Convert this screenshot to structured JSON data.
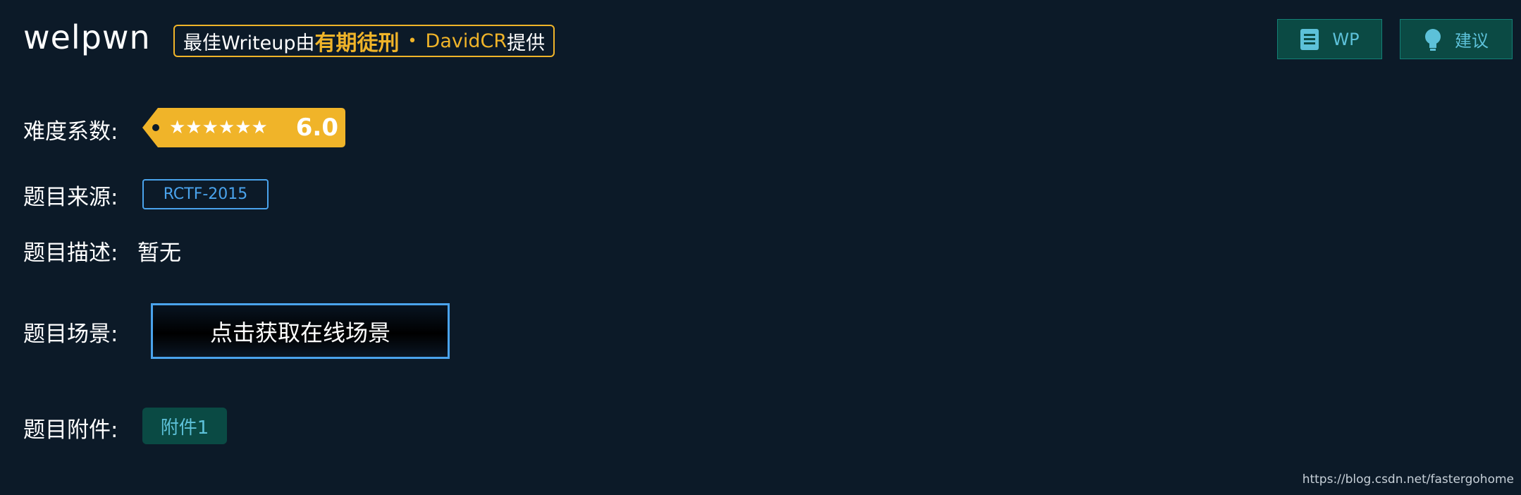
{
  "challenge": {
    "title": "welpwn"
  },
  "writeup_badge": {
    "prefix": "最佳Writeup由",
    "team": "有期徒刑",
    "separator": "•",
    "author": "DavidCR",
    "suffix": "提供"
  },
  "top_buttons": {
    "wp_label": "WP",
    "suggest_label": "建议"
  },
  "difficulty": {
    "label": "难度系数:",
    "stars": "★★★★★★",
    "score": "6.0",
    "tag_color": "#f0b429"
  },
  "source": {
    "label": "题目来源:",
    "value": "RCTF-2015"
  },
  "description": {
    "label": "题目描述:",
    "value": "暂无"
  },
  "scene": {
    "label": "题目场景:",
    "button_label": "点击获取在线场景"
  },
  "attachments": {
    "label": "题目附件:",
    "items": [
      "附件1"
    ]
  },
  "watermark": "https://blog.csdn.net/fastergohome",
  "colors": {
    "background": "#0c1a28",
    "accent_blue": "#4aa3ec",
    "teal_button": "#0b4a44",
    "teal_text": "#5dc1d9",
    "gold": "#f0b429"
  }
}
